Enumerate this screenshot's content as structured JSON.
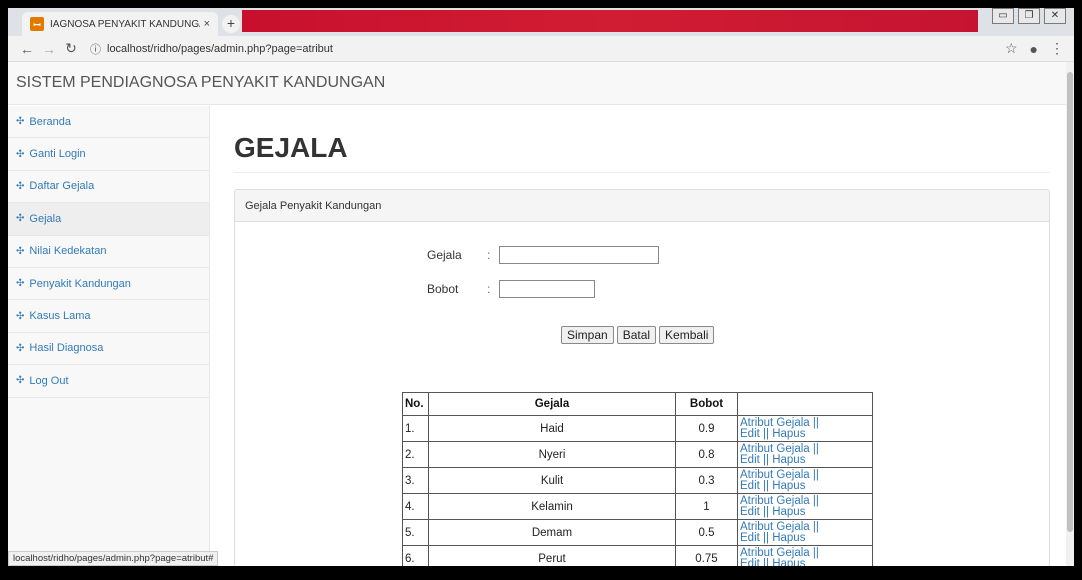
{
  "browser": {
    "tab_title": "IAGNOSA PENYAKIT KANDUNGA",
    "tab_close": "×",
    "new_tab": "+",
    "url": "localhost/ridho/pages/admin.php?page=atribut",
    "status_url": "localhost/ridho/pages/admin.php?page=atribut#"
  },
  "header": {
    "brand": "SISTEM PENDIAGNOSA PENYAKIT KANDUNGAN"
  },
  "sidebar": {
    "items": [
      {
        "label": "Beranda",
        "icon": "dashboard-icon"
      },
      {
        "label": "Ganti Login",
        "icon": "dashboard-icon"
      },
      {
        "label": "Daftar Gejala",
        "icon": "dashboard-icon"
      },
      {
        "label": "Gejala",
        "icon": "dashboard-icon",
        "active": true
      },
      {
        "label": "Nilai Kedekatan",
        "icon": "dashboard-icon"
      },
      {
        "label": "Penyakit Kandungan",
        "icon": "dashboard-icon"
      },
      {
        "label": "Kasus Lama",
        "icon": "dashboard-icon"
      },
      {
        "label": "Hasil Diagnosa",
        "icon": "dashboard-icon"
      },
      {
        "label": "Log Out",
        "icon": "dashboard-icon"
      }
    ]
  },
  "main": {
    "title": "GEJALA",
    "panel_title": "Gejala Penyakit Kandungan",
    "form": {
      "gejala_label": "Gejala",
      "bobot_label": "Bobot",
      "colon": ":",
      "gejala_value": "",
      "bobot_value": ""
    },
    "buttons": {
      "save": "Simpan",
      "cancel": "Batal",
      "back": "Kembali"
    },
    "table": {
      "headers": [
        "No.",
        "Gejala",
        "Bobot",
        ""
      ],
      "action_line1": "Atribut Gejala ||",
      "action_edit": "Edit",
      "action_sep": " || ",
      "action_delete": "Hapus",
      "rows": [
        {
          "no": "1.",
          "gejala": "Haid",
          "bobot": "0.9"
        },
        {
          "no": "2.",
          "gejala": "Nyeri",
          "bobot": "0.8"
        },
        {
          "no": "3.",
          "gejala": "Kulit",
          "bobot": "0.3"
        },
        {
          "no": "4.",
          "gejala": "Kelamin",
          "bobot": "1"
        },
        {
          "no": "5.",
          "gejala": "Demam",
          "bobot": "0.5"
        },
        {
          "no": "6.",
          "gejala": "Perut",
          "bobot": "0.75"
        }
      ]
    }
  }
}
